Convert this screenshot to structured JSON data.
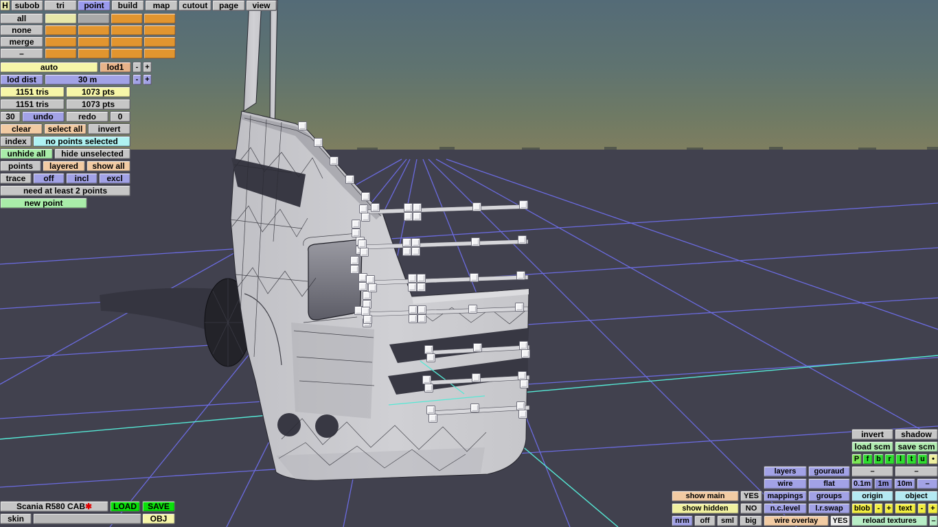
{
  "tabs": {
    "h": "H",
    "subob": "subob",
    "tri": "tri",
    "point": "point",
    "build": "build",
    "map": "map",
    "cutout": "cutout",
    "page": "page",
    "view": "view",
    "selected": "point"
  },
  "subobject": {
    "all": "all",
    "none": "none",
    "merge": "merge",
    "minus": "–"
  },
  "lod": {
    "auto": "auto",
    "lod1": "lod1",
    "minus": "-",
    "plus": "+",
    "dist_label": "lod dist",
    "dist_value": "30 m",
    "dist_minus": "-",
    "dist_plus": "+"
  },
  "stats": {
    "tris_selected": "1151 tris",
    "pts_selected": "1073 pts",
    "tris_total": "1151 tris",
    "pts_total": "1073 pts"
  },
  "history": {
    "undo_steps": "30",
    "undo": "undo",
    "redo": "redo",
    "redo_steps": "0"
  },
  "selection": {
    "clear": "clear",
    "select_all": "select all",
    "invert": "invert",
    "index": "index",
    "status": "no points selected"
  },
  "visibility": {
    "unhide_all": "unhide all",
    "hide_unselected": "hide unselected",
    "points": "points",
    "layered": "layered",
    "show_all": "show all"
  },
  "trace": {
    "label": "trace",
    "off": "off",
    "incl": "incl",
    "excl": "excl"
  },
  "hint": {
    "message": "need at least 2 points",
    "new_point": "new point"
  },
  "file": {
    "model": "Scania R580 CAB",
    "modified": "✱",
    "load": "LOAD",
    "save": "SAVE",
    "skin": "skin",
    "obj": "OBJ"
  },
  "right": {
    "invert": "invert",
    "shadow": "shadow",
    "load_scm": "load scm",
    "save_scm": "save scm",
    "proj_p": "P",
    "proj_f": "f",
    "proj_b": "b",
    "proj_r": "r",
    "proj_l": "l",
    "proj_t": "t",
    "proj_u": "u",
    "proj_dot": "•",
    "layers": "layers",
    "gouraud": "gouraud",
    "dash1": "–",
    "dash2": "–",
    "wire": "wire",
    "flat": "flat",
    "m01": "0.1m",
    "m1": "1m",
    "m10": "10m",
    "mdash": "–",
    "show_main": "show main",
    "show_main_val": "YES",
    "mappings": "mappings",
    "groups": "groups",
    "origin": "origin",
    "object": "object",
    "show_hidden": "show hidden",
    "show_hidden_val": "NO",
    "nclevel": "n.c.level",
    "lrswap": "l.r.swap",
    "blob": "blob",
    "blob_minus": "-",
    "blob_plus": "+",
    "text": "text",
    "text_minus": "-",
    "text_plus": "+",
    "nrm": "nrm",
    "off": "off",
    "sml": "sml",
    "big": "big",
    "wire_overlay": "wire overlay",
    "wire_overlay_val": "YES",
    "reload_textures": "reload textures",
    "reload_dash": "–"
  },
  "colors": {
    "selected_tab": "#9a9aee",
    "subobject_cell": "#e2952f",
    "grid_line": "#6b6be0",
    "grid_accent_line": "#55e8d5",
    "sky_top": "#546b77",
    "ground": "#41414e"
  }
}
